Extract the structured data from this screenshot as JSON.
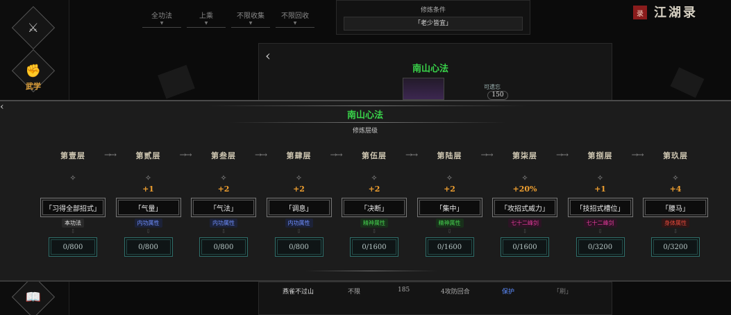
{
  "app": {
    "title": "江湖录",
    "stamp": "录"
  },
  "sidenav": {
    "martial_label": "武学"
  },
  "filters": [
    "全功法",
    "上乘",
    "不限收集",
    "不限回收"
  ],
  "cultivation_conditions": {
    "header": "修炼条件",
    "value": "「老少皆宜」"
  },
  "back_panel": {
    "title": "南山心法",
    "forget_label": "可遗忘",
    "forget_value": "150"
  },
  "overlay": {
    "title": "南山心法",
    "subtitle": "修炼层级"
  },
  "tiers": [
    {
      "name": "第壹层",
      "bonus": "",
      "node": "「习得全部招式」",
      "badge": "本功法",
      "badge_color": "#e8e8e8",
      "badge_bg": "#2a2a2a",
      "progress": "0/800"
    },
    {
      "name": "第贰层",
      "bonus": "+1",
      "node": "「气量」",
      "badge": "内功属性",
      "badge_color": "#6f8fff",
      "badge_bg": "#1c2238",
      "progress": "0/800"
    },
    {
      "name": "第叁层",
      "bonus": "+2",
      "node": "「气法」",
      "badge": "内功属性",
      "badge_color": "#6f8fff",
      "badge_bg": "#1c2238",
      "progress": "0/800"
    },
    {
      "name": "第肆层",
      "bonus": "+2",
      "node": "「调息」",
      "badge": "内功属性",
      "badge_color": "#6f8fff",
      "badge_bg": "#1c2238",
      "progress": "0/800"
    },
    {
      "name": "第伍层",
      "bonus": "+2",
      "node": "「决断」",
      "badge": "精神属性",
      "badge_color": "#45d14e",
      "badge_bg": "#18301a",
      "progress": "0/1600"
    },
    {
      "name": "第陆层",
      "bonus": "+2",
      "node": "「集中」",
      "badge": "精神属性",
      "badge_color": "#45d14e",
      "badge_bg": "#18301a",
      "progress": "0/1600"
    },
    {
      "name": "第柒层",
      "bonus": "+20%",
      "node": "「攻招式威力」",
      "badge": "七十二峰剑",
      "badge_color": "#e23a9a",
      "badge_bg": "#2c1424",
      "progress": "0/1600"
    },
    {
      "name": "第捌层",
      "bonus": "+1",
      "node": "「技招式槽位」",
      "badge": "七十二峰剑",
      "badge_color": "#e23a9a",
      "badge_bg": "#2c1424",
      "progress": "0/3200"
    },
    {
      "name": "第玖层",
      "bonus": "+4",
      "node": "「腰马」",
      "badge": "身体属性",
      "badge_color": "#e2483a",
      "badge_bg": "#301616",
      "progress": "0/3200"
    }
  ],
  "bottom_row": {
    "name": "燕雀不过山",
    "limit": "不限",
    "value": "185",
    "rounds": "4攻防回合",
    "tag": "保护",
    "extra": "「刷」"
  },
  "colors": {
    "accent_green": "#39d44a",
    "bonus_orange": "#f0a030"
  }
}
